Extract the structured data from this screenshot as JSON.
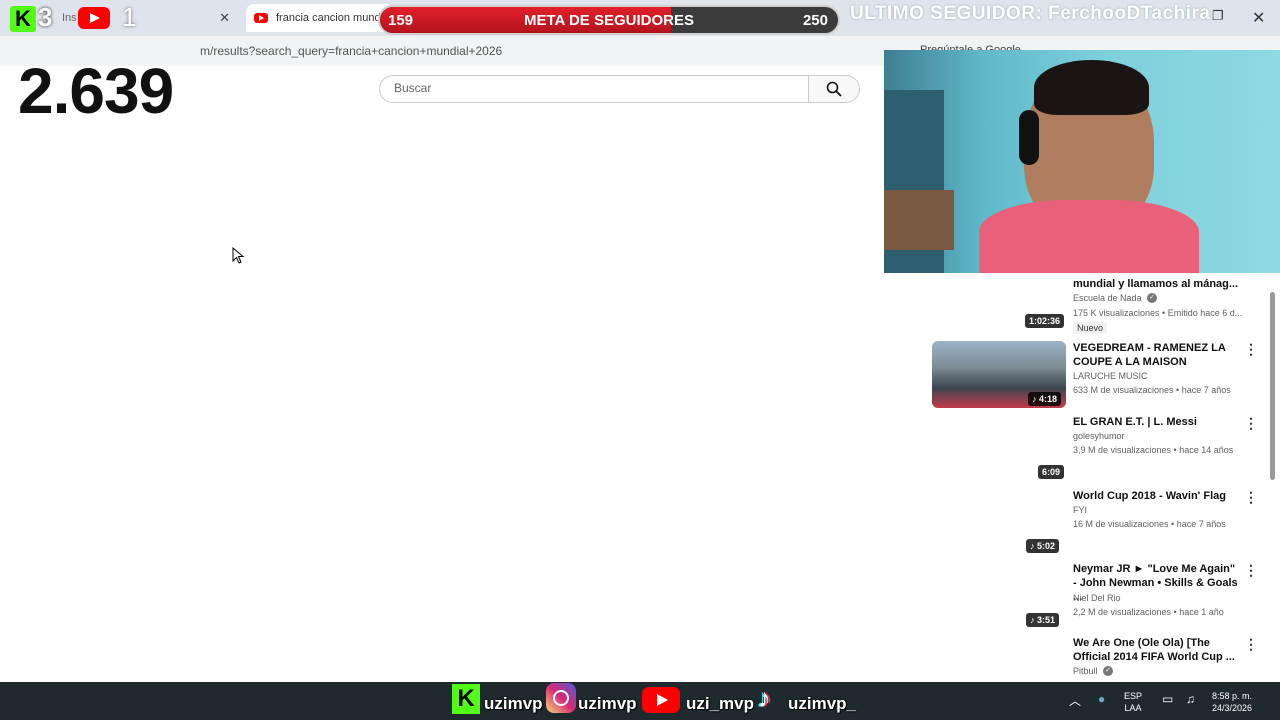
{
  "browser": {
    "tab1_label": "Ins",
    "tab2_label": "francia cancion mundial",
    "close_glyph": "✕",
    "url": "m/results?search_query=francia+cancion+mundial+2026",
    "ask_google": "Pregúntale a Google"
  },
  "overlay": {
    "kick_letter": "K",
    "kick_count": "3",
    "youtube_count": "1",
    "goal": {
      "current": "159",
      "title": "META DE SEGUIDORES",
      "target": "250",
      "progress": 0.636
    },
    "last_follower": "ULTIMO SEGUIDOR: FerchooDTachira",
    "big_counter": "2.639"
  },
  "search": {
    "placeholder": "Buscar",
    "value": ""
  },
  "sidebar": {
    "videos": [
      {
        "title": "mundial y llamamos al mánag...",
        "channel": "Escuela de Nada",
        "meta": "175 K visualizaciones • Emitido hace 6 d...",
        "duration": "1:02:36",
        "badge": "Nuevo"
      },
      {
        "title": "VEGEDREAM - RAMENEZ LA COUPE A LA MAISON",
        "channel": "LARUCHE MUSIC",
        "meta": "633 M de visualizaciones • hace 7 años",
        "duration": "4:18"
      },
      {
        "title": "EL GRAN E.T. | L. Messi",
        "channel": "golesyhumor",
        "meta": "3,9 M de visualizaciones • hace 14 años",
        "duration": "6:09"
      },
      {
        "title": "World Cup 2018 - Wavin' Flag",
        "channel": "FYI",
        "meta": "16 M de visualizaciones • hace 7 años",
        "duration": "5:02"
      },
      {
        "title": "Neymar JR ► \"Love Me Again\" - John Newman • Skills & Goals ...",
        "channel": "Niel Del Rio",
        "meta": "2,2 M de visualizaciones • hace 1 año",
        "duration": "3:51"
      },
      {
        "title": "We Are One (Ole Ola) [The Official 2014 FIFA World Cup ...",
        "channel": "Pitbull",
        "meta": "",
        "duration": ""
      }
    ]
  },
  "taskbar": {
    "kick_letter": "K",
    "handle1": "uzimvp",
    "handle2": "uzimvp",
    "handle3": "uzi_mvp",
    "handle4": "uzimvp_",
    "lang": "ESP",
    "layout": "LAA",
    "time": "8:58 p. m.",
    "date": "24/3/2026"
  }
}
